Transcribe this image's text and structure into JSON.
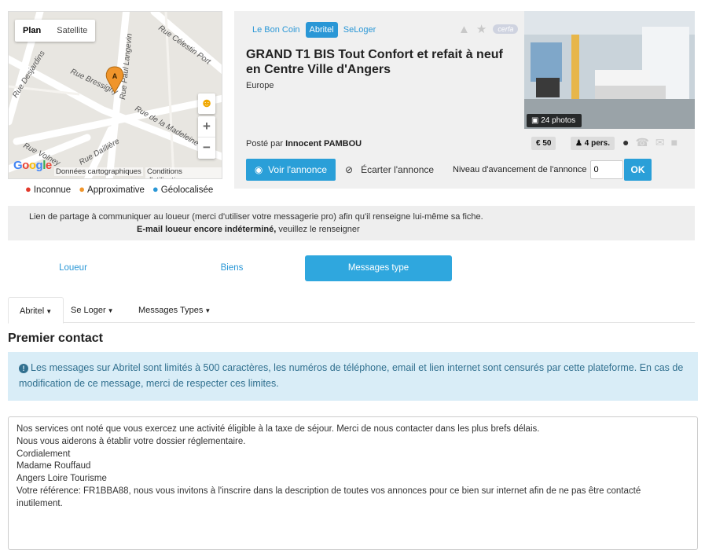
{
  "map": {
    "type_plan": "Plan",
    "type_satellite": "Satellite",
    "marker_label": "A",
    "streets": [
      "Rue Desjardins",
      "Rue Bressigny",
      "Rue Paul Langevin",
      "Rue Célestin Port",
      "Rue de la Madeleine",
      "Rue Volney",
      "Rue Daillière"
    ],
    "zoom_in": "+",
    "zoom_out": "−",
    "google": "Google",
    "credit": "Données cartographiques",
    "terms": "Conditions d'utilisation"
  },
  "legend": [
    {
      "label": "Inconnue",
      "color": "#e2392b"
    },
    {
      "label": "Approximative",
      "color": "#f0952b"
    },
    {
      "label": "Géolocalisée",
      "color": "#2a97d6"
    }
  ],
  "listing": {
    "sources": [
      "Le Bon Coin",
      "Abritel",
      "SeLoger"
    ],
    "active_source": "Abritel",
    "cerfa": "cerfa",
    "title": "GRAND T1 BIS Tout Confort et refait à neuf en Centre Ville d'Angers",
    "region": "Europe",
    "posted_prefix": "Posté par",
    "posted_by": "Innocent PAMBOU",
    "photo_count": "24 photos",
    "price": "€ 50",
    "persons": "4 pers.",
    "voir_label": "Voir l'annonce",
    "ecarter_label": "Écarter l'annonce",
    "niveau_label": "Niveau d'avancement de l'annonce",
    "niveau_value": "0",
    "percent": "%",
    "ok_label": "OK"
  },
  "share": {
    "line1": "Lien de partage à communiquer au loueur (merci d'utiliser votre messagerie pro) afin qu'il renseigne lui-même sa fiche.",
    "line2_bold": "E-mail loueur encore indéterminé,",
    "line2_rest": " veuillez le renseigner"
  },
  "tabs": [
    "Loueur",
    "Biens",
    "Messages type"
  ],
  "active_tab": "Messages type",
  "subnav": [
    "Abritel",
    "Se Loger",
    "Messages Types"
  ],
  "section_title": "Premier contact",
  "info_text": "Les messages sur Abritel sont limités à 500 caractères, les numéros de téléphone, email et lien internet sont censurés par cette plateforme. En cas de modification de ce message, merci de respecter ces limites.",
  "message": "Nos services ont noté que vous exercez une activité éligible à la taxe de séjour. Merci de nous contacter dans les plus brefs délais.\nNous vous aiderons à établir votre dossier réglementaire.\nCordialement\nMadame Rouffaud\nAngers Loire Tourisme\nVotre référence: FR1BBA88, nous vous invitons à l'inscrire dans la description de toutes vos annonces pour ce bien sur internet afin de ne pas être contacté inutilement."
}
